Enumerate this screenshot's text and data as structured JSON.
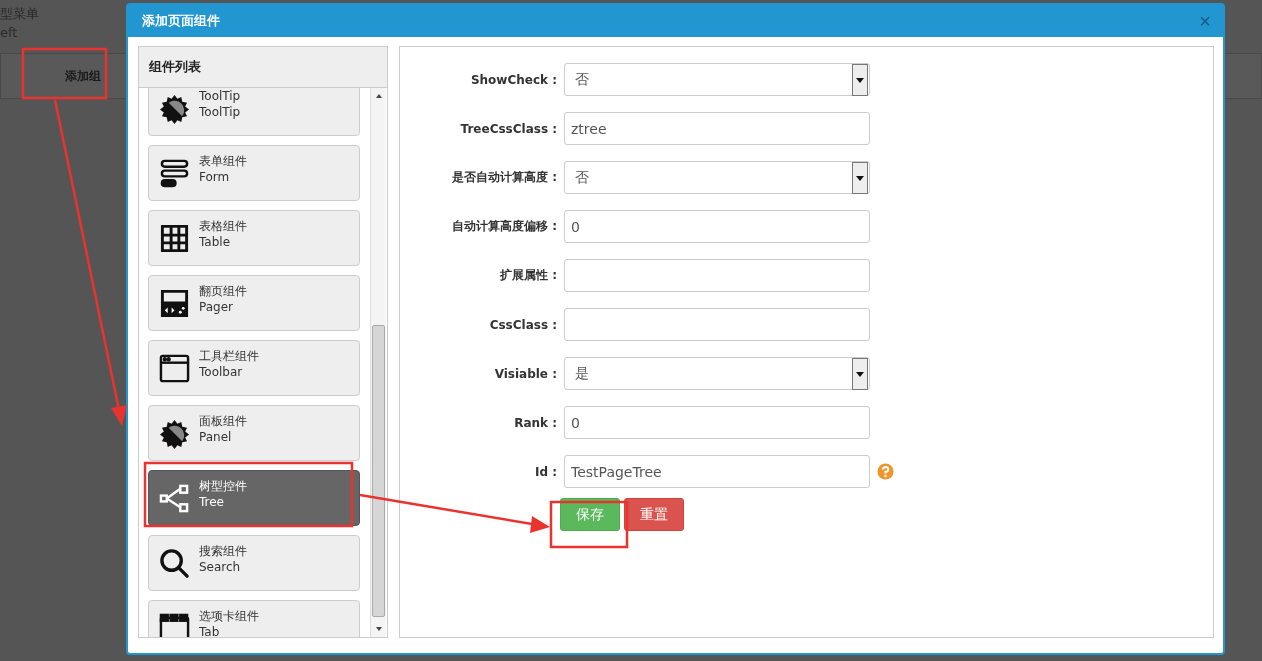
{
  "background": {
    "breadcrumb": "型菜单",
    "field": "eft",
    "button": "添加组"
  },
  "dialog": {
    "title": "添加页面组件",
    "close": "×"
  },
  "component_list": {
    "title": "组件列表",
    "items": [
      {
        "kind": "gear",
        "name": "ToolTip",
        "code": "ToolTip",
        "selected": false
      },
      {
        "kind": "form",
        "name": "表单组件",
        "code": "Form",
        "selected": false
      },
      {
        "kind": "table",
        "name": "表格组件",
        "code": "Table",
        "selected": false
      },
      {
        "kind": "pager",
        "name": "翻页组件",
        "code": "Pager",
        "selected": false
      },
      {
        "kind": "toolbar",
        "name": "工具栏组件",
        "code": "Toolbar",
        "selected": false
      },
      {
        "kind": "gear",
        "name": "面板组件",
        "code": "Panel",
        "selected": false
      },
      {
        "kind": "tree",
        "name": "树型控件",
        "code": "Tree",
        "selected": true
      },
      {
        "kind": "search",
        "name": "搜索组件",
        "code": "Search",
        "selected": false
      },
      {
        "kind": "tab",
        "name": "选项卡组件",
        "code": "Tab",
        "selected": false
      }
    ]
  },
  "form": {
    "fields": [
      {
        "label": "ShowCheck :",
        "kind": "select",
        "value": "否"
      },
      {
        "label": "TreeCssClass :",
        "kind": "text",
        "value": "ztree"
      },
      {
        "label": "是否自动计算高度 :",
        "kind": "select",
        "value": "否"
      },
      {
        "label": "自动计算高度偏移 :",
        "kind": "text",
        "value": "0"
      },
      {
        "label": "扩展属性 :",
        "kind": "text"
      },
      {
        "label": "CssClass :",
        "kind": "text"
      },
      {
        "label": "Visiable :",
        "kind": "select",
        "value": "是"
      },
      {
        "label": "Rank :",
        "kind": "text",
        "value": "0"
      },
      {
        "label": "Id :",
        "kind": "text",
        "value": "TestPageTree",
        "help": true
      }
    ],
    "buttons": [
      {
        "label": "保存",
        "kind": "primary"
      },
      {
        "label": "重置",
        "kind": "danger"
      }
    ]
  }
}
